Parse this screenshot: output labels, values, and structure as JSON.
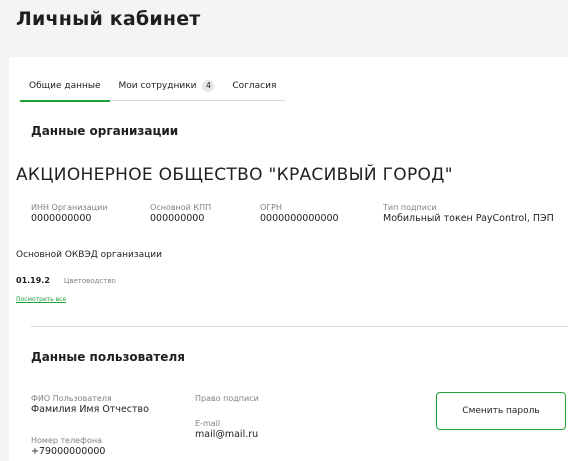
{
  "page": {
    "title": "Личный кабинет"
  },
  "tabs": [
    {
      "label": "Общие данные",
      "active": true
    },
    {
      "label": "Мои сотрудники",
      "badge": "4",
      "active": false
    },
    {
      "label": "Согласия",
      "active": false
    }
  ],
  "organization": {
    "section_title": "Данные организации",
    "name": "АКЦИОНЕРНОЕ ОБЩЕСТВО \"КРАСИВЫЙ ГОРОД\"",
    "fields": [
      {
        "label": "ИНН Организации",
        "value": "0000000000"
      },
      {
        "label": "Основной КПП",
        "value": "000000000"
      },
      {
        "label": "ОГРН",
        "value": "0000000000000"
      },
      {
        "label": "Тип подписи",
        "value": "Мобильный токен PayControl, ПЭП"
      }
    ],
    "okved": {
      "title": "Основной ОКВЭД организации",
      "code": "01.19.2",
      "name": "Цветоводство",
      "show_all": "Посмотреть все"
    }
  },
  "user": {
    "section_title": "Данные пользователя",
    "full_name_label": "ФИО Пользователя",
    "full_name": "Фамилия Имя Отчество",
    "phone_label": "Номер телефона",
    "phone": "+79000000000",
    "sign_right_label": "Право подписи",
    "email_label": "E-mail",
    "email": "mail@mail.ru",
    "change_password_button": "Сменить пароль"
  },
  "colors": {
    "accent": "#21a038",
    "background": "#f4f4f4",
    "muted_text": "#7d838a"
  }
}
